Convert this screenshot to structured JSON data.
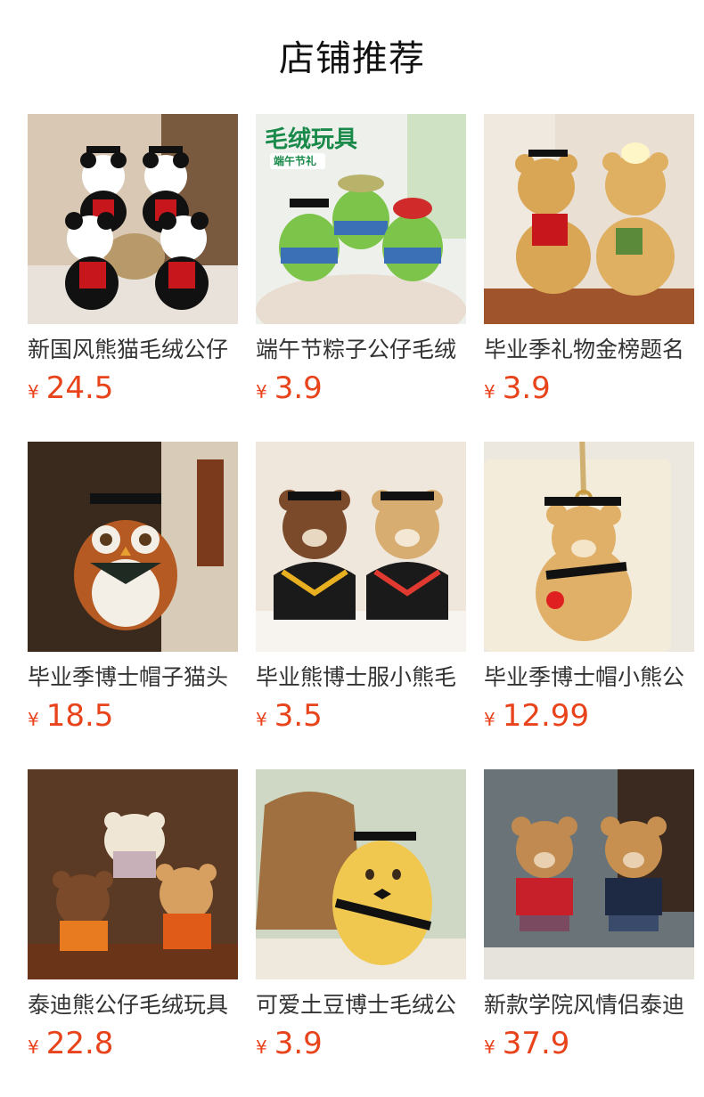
{
  "page_title": "店铺推荐",
  "currency_symbol": "¥",
  "price_color": "#e8431b",
  "products": [
    {
      "name": "新国风熊猫毛绒公仔",
      "price": "24.5",
      "image": "panda-plush-image",
      "banner": ""
    },
    {
      "name": "端午节粽子公仔毛绒",
      "price": "3.9",
      "image": "zongzi-plush-image",
      "banner": "毛绒玩具",
      "sub_banner": "端午节礼"
    },
    {
      "name": "毕业季礼物金榜题名",
      "price": "3.9",
      "image": "graduation-bear-image",
      "banner": ""
    },
    {
      "name": "毕业季博士帽子猫头",
      "price": "18.5",
      "image": "owl-plush-image",
      "banner": ""
    },
    {
      "name": "毕业熊博士服小熊毛",
      "price": "3.5",
      "image": "graduation-gown-bears-image",
      "banner": ""
    },
    {
      "name": "毕业季博士帽小熊公",
      "price": "12.99",
      "image": "bear-keychain-image",
      "banner": ""
    },
    {
      "name": "泰迪熊公仔毛绒玩具",
      "price": "22.8",
      "image": "teddy-bears-image",
      "banner": ""
    },
    {
      "name": "可爱土豆博士毛绒公",
      "price": "3.9",
      "image": "potato-plush-image",
      "banner": ""
    },
    {
      "name": "新款学院风情侣泰迪",
      "price": "37.9",
      "image": "college-teddy-couple-image",
      "banner": ""
    }
  ]
}
